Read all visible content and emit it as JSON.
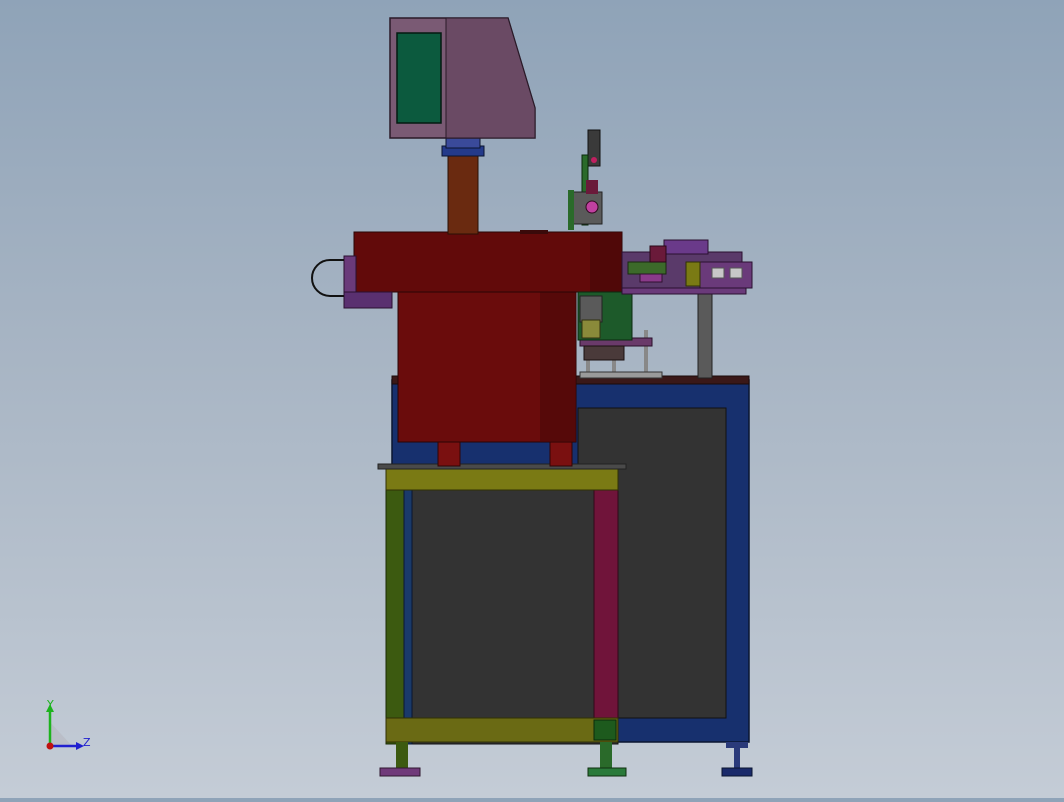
{
  "viewport": {
    "background_top": "#8fa3b8",
    "background_bottom": "#c4ccd6"
  },
  "triad": {
    "x_label": "",
    "y_label": "Y",
    "z_label": "Z",
    "y_color": "#1db31d",
    "z_color": "#2020d0",
    "origin_color": "#c01010"
  },
  "colors": {
    "monitor_body": "#7a5a74",
    "monitor_screen": "#0c5a3e",
    "bowl": "#6a0c0c",
    "cabinet_frame": "#17306e",
    "panel": "#333333",
    "frame_green": "#3c5a10",
    "frame_olive": "#7a7a14",
    "frame_magenta": "#70143a",
    "fixture_purple": "#6a3a7a"
  }
}
